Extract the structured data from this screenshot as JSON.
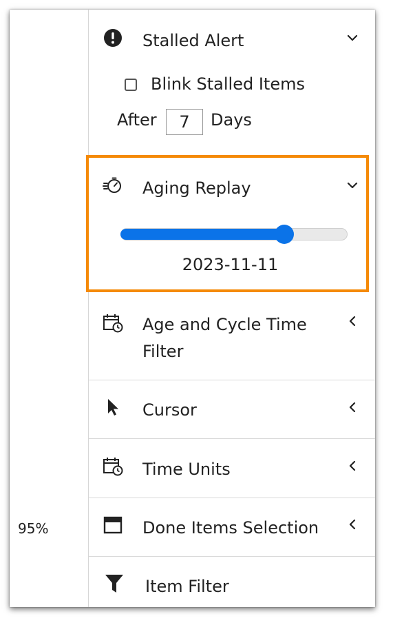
{
  "zoom": "95%",
  "stalled_alert": {
    "title": "Stalled Alert",
    "icon": "exclamation-circle-icon",
    "blink_label": "Blink Stalled Items",
    "blink_checked": false,
    "after_label": "After",
    "days_value": "7",
    "days_label": "Days"
  },
  "aging_replay": {
    "title": "Aging Replay",
    "icon": "stopwatch-icon",
    "slider_level": 0.72,
    "date": "2023-11-11",
    "highlight_color": "#f58a07",
    "accent_color": "#0b73e8"
  },
  "sections": [
    {
      "title_line1": "Age and Cycle Time",
      "title_line2": "Filter",
      "icon": "calendar-clock-icon"
    },
    {
      "title": "Cursor",
      "icon": "cursor-arrow-icon"
    },
    {
      "title": "Time Units",
      "icon": "calendar-clock-icon"
    },
    {
      "title": "Done Items Selection",
      "icon": "window-panel-icon"
    },
    {
      "title": "Item Filter",
      "icon": "funnel-icon"
    }
  ]
}
